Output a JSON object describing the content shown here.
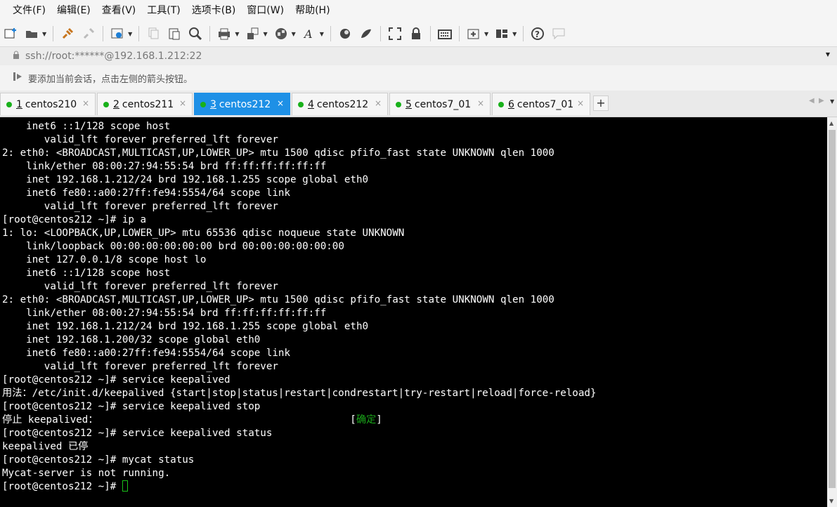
{
  "menu": [
    {
      "label": "文件(F)"
    },
    {
      "label": "编辑(E)"
    },
    {
      "label": "查看(V)"
    },
    {
      "label": "工具(T)"
    },
    {
      "label": "选项卡(B)"
    },
    {
      "label": "窗口(W)"
    },
    {
      "label": "帮助(H)"
    }
  ],
  "address": {
    "text": "ssh://root:******@192.168.1.212:22"
  },
  "hint": {
    "text": "要添加当前会话，点击左侧的箭头按钮。"
  },
  "tabs": [
    {
      "num": "1",
      "label": "centos210",
      "active": false
    },
    {
      "num": "2",
      "label": "centos211",
      "active": false
    },
    {
      "num": "3",
      "label": "centos212",
      "active": true
    },
    {
      "num": "4",
      "label": "centos212",
      "active": false
    },
    {
      "num": "5",
      "label": "centos7_01",
      "active": false
    },
    {
      "num": "6",
      "label": "centos7_01",
      "active": false
    }
  ],
  "tab_close": "×",
  "tab_add": "+",
  "colors": {
    "accent": "#1e90e6",
    "status_dot": "#19b11b",
    "terminal_bg": "#000000",
    "ok_text": "#1aa71a"
  },
  "terminal": {
    "lines": [
      "    inet6 ::1/128 scope host",
      "       valid_lft forever preferred_lft forever",
      "2: eth0: <BROADCAST,MULTICAST,UP,LOWER_UP> mtu 1500 qdisc pfifo_fast state UNKNOWN qlen 1000",
      "    link/ether 08:00:27:94:55:54 brd ff:ff:ff:ff:ff:ff",
      "    inet 192.168.1.212/24 brd 192.168.1.255 scope global eth0",
      "    inet6 fe80::a00:27ff:fe94:5554/64 scope link",
      "       valid_lft forever preferred_lft forever",
      "[root@centos212 ~]# ip a",
      "1: lo: <LOOPBACK,UP,LOWER_UP> mtu 65536 qdisc noqueue state UNKNOWN",
      "    link/loopback 00:00:00:00:00:00 brd 00:00:00:00:00:00",
      "    inet 127.0.0.1/8 scope host lo",
      "    inet6 ::1/128 scope host",
      "       valid_lft forever preferred_lft forever",
      "2: eth0: <BROADCAST,MULTICAST,UP,LOWER_UP> mtu 1500 qdisc pfifo_fast state UNKNOWN qlen 1000",
      "    link/ether 08:00:27:94:55:54 brd ff:ff:ff:ff:ff:ff",
      "    inet 192.168.1.212/24 brd 192.168.1.255 scope global eth0",
      "    inet 192.168.1.200/32 scope global eth0",
      "    inet6 fe80::a00:27ff:fe94:5554/64 scope link",
      "       valid_lft forever preferred_lft forever",
      "[root@centos212 ~]# service keepalived",
      "用法：/etc/init.d/keepalived {start|stop|status|restart|condrestart|try-restart|reload|force-reload}",
      "[root@centos212 ~]# service keepalived stop"
    ],
    "stop_prefix": "停止 keepalived：",
    "stop_pad": "                                          ",
    "ok_open": "[",
    "ok_text": "确定",
    "ok_close": "]",
    "lines_after": [
      "[root@centos212 ~]# service keepalived status",
      "keepalived 已停",
      "[root@centos212 ~]# mycat status",
      "Mycat-server is not running."
    ],
    "prompt": "[root@centos212 ~]# "
  }
}
